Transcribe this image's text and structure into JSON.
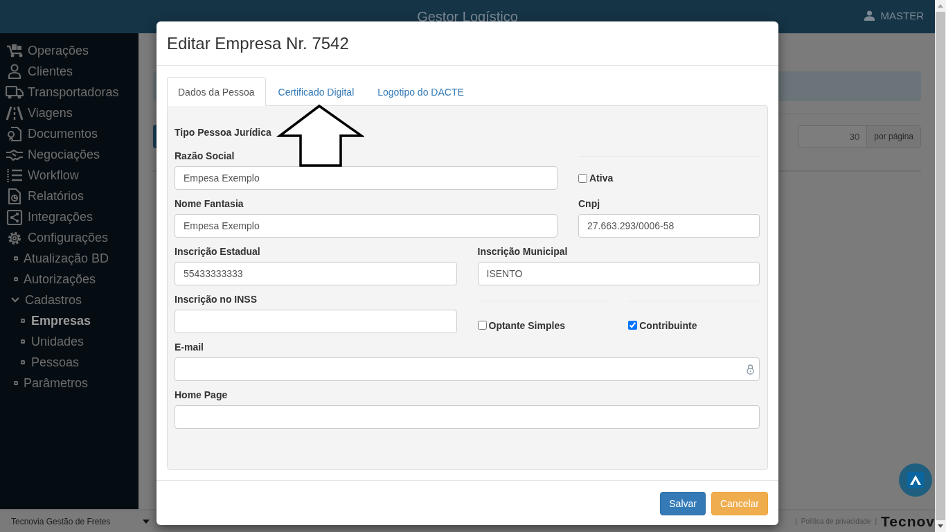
{
  "app": {
    "title": "Gestor Logístico",
    "user": "MASTER"
  },
  "sidebar": {
    "items": [
      {
        "label": "Operações"
      },
      {
        "label": "Clientes"
      },
      {
        "label": "Transportadoras"
      },
      {
        "label": "Viagens"
      },
      {
        "label": "Documentos"
      },
      {
        "label": "Negociações"
      },
      {
        "label": "Workflow"
      },
      {
        "label": "Relatórios"
      },
      {
        "label": "Integrações"
      },
      {
        "label": "Configurações",
        "children": [
          {
            "label": "Atualização BD",
            "selected": false
          },
          {
            "label": "Autorizações",
            "selected": false
          },
          {
            "label": "Cadastros",
            "expanded": true,
            "children": [
              {
                "label": "Empresas",
                "selected": true
              },
              {
                "label": "Unidades",
                "selected": false
              },
              {
                "label": "Pessoas",
                "selected": false
              }
            ]
          },
          {
            "label": "Parâmetros",
            "selected": false
          }
        ]
      }
    ]
  },
  "page": {
    "per_page": "30",
    "per_page_label": "por página"
  },
  "footer": {
    "company": "Tecnovia Gestão de Fretes",
    "separator_1": "|",
    "privacy": "Política de privacidade",
    "separator_2": "|",
    "logo": "Tecnov"
  },
  "dialog": {
    "title": "Editar Empresa Nr. 7542",
    "tabs": [
      {
        "label": "Dados da Pessoa",
        "selected": true
      },
      {
        "label": "Certificado Digital",
        "selected": false
      },
      {
        "label": "Logotipo do DACTE",
        "selected": false
      }
    ],
    "heading": "Tipo Pessoa Jurídica",
    "fields": [
      {
        "label": "Razão Social",
        "value": "Empesa Exemplo"
      },
      {
        "label": "Nome Fantasia",
        "value": "Empesa Exemplo"
      },
      {
        "label": "Cnpj",
        "value": "27.663.293/0006-58"
      },
      {
        "label": "Inscrição Estadual",
        "value": "55433333333"
      },
      {
        "label": "Inscrição Municipal",
        "value": "ISENTO"
      },
      {
        "label": "Inscrição no INSS"
      },
      {
        "label": "E-mail"
      },
      {
        "label": "Home Page"
      }
    ],
    "checkboxes": [
      {
        "label": "Ativa",
        "checked": false
      },
      {
        "label": "Optante Simples",
        "checked": false
      },
      {
        "label": "Contribuinte",
        "checked": true
      }
    ],
    "buttons": [
      {
        "label": "Salvar",
        "kind": "primary"
      },
      {
        "label": "Cancelar",
        "kind": "warning"
      }
    ]
  }
}
